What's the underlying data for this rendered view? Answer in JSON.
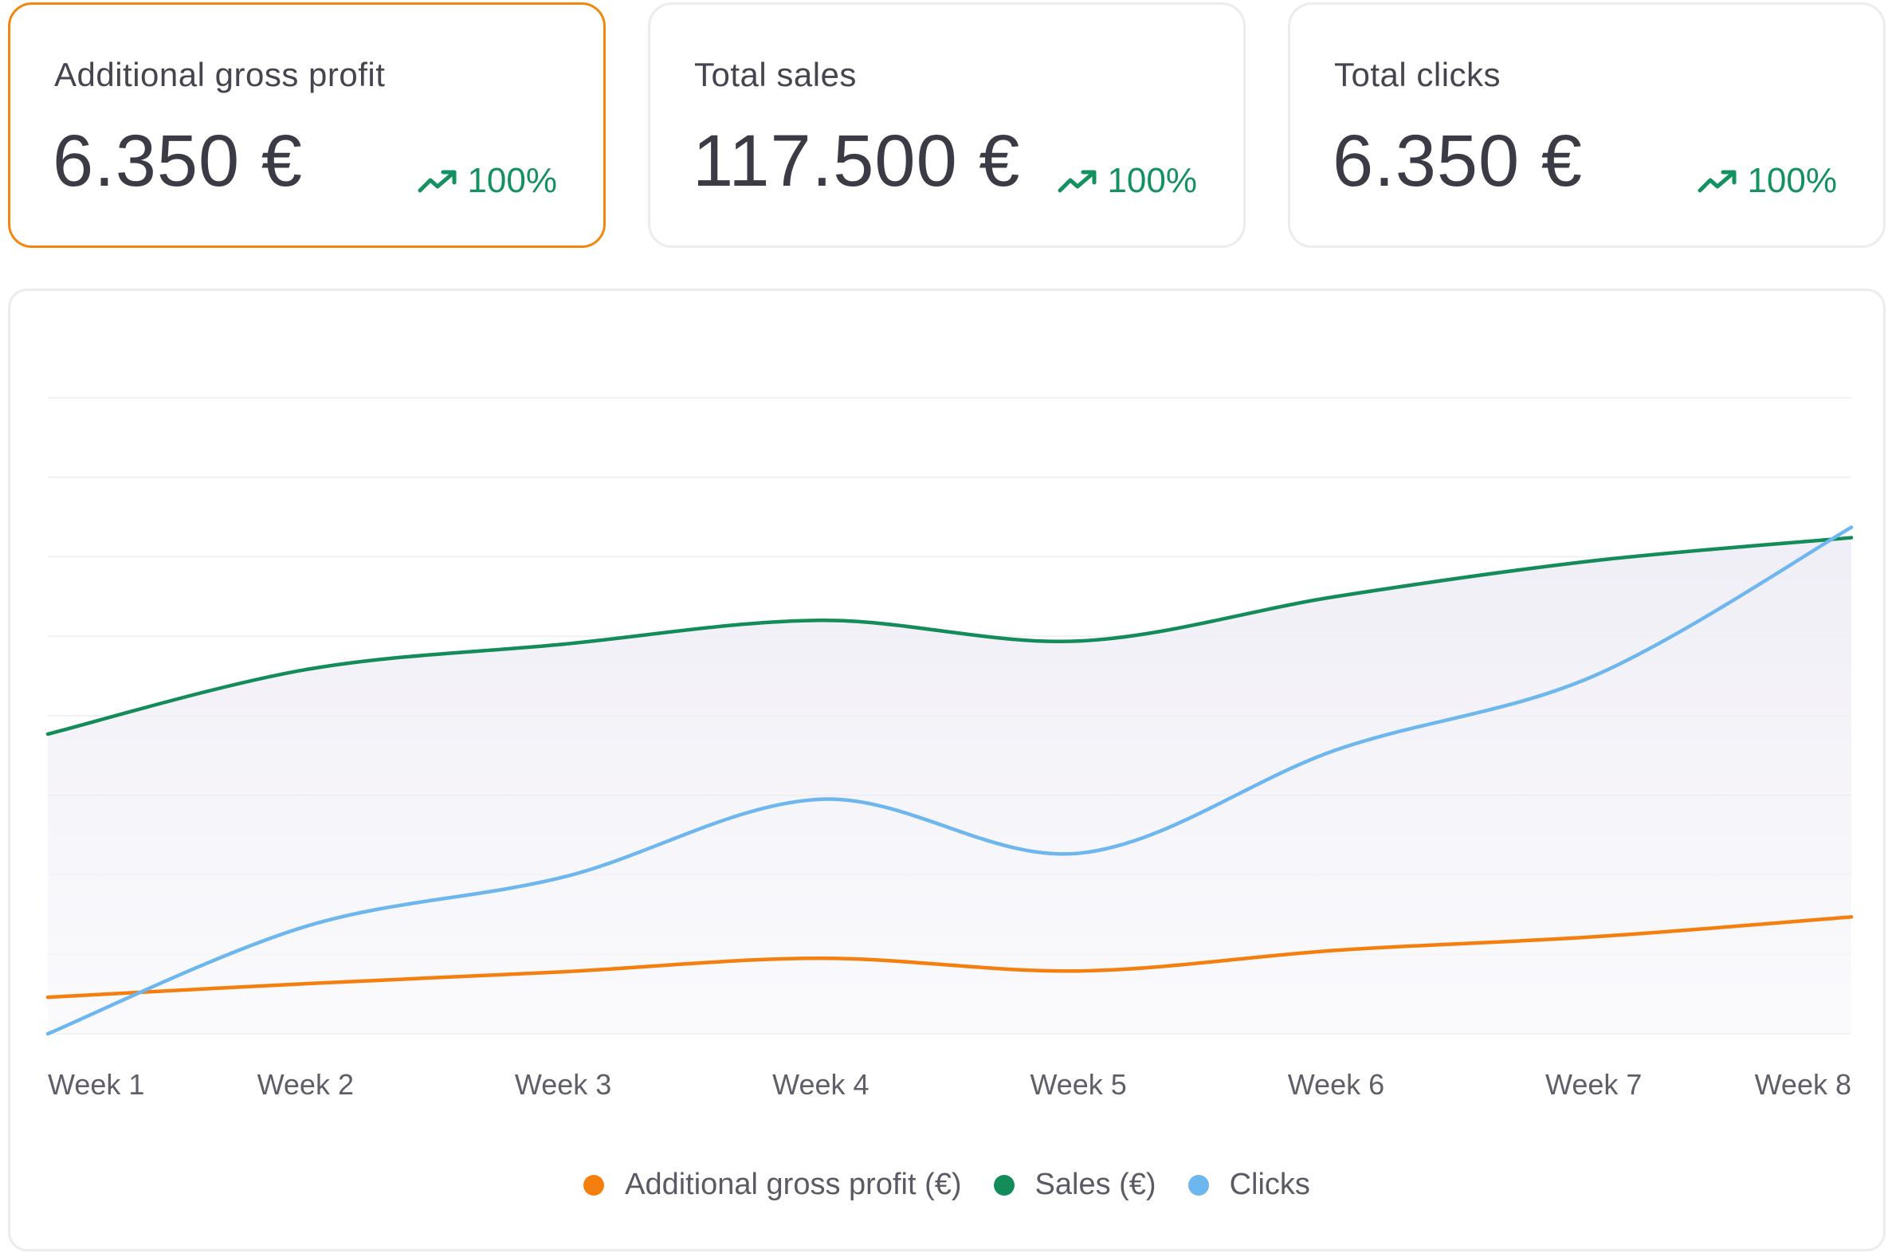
{
  "kpis": [
    {
      "label": "Additional gross profit",
      "value": "6.350 €",
      "change": "100%",
      "selected": true
    },
    {
      "label": "Total sales",
      "value": "117.500 €",
      "change": "100%",
      "selected": false
    },
    {
      "label": "Total clicks",
      "value": "6.350 €",
      "change": "100%",
      "selected": false
    }
  ],
  "colors": {
    "profit": "#f57f0e",
    "sales": "#148c5a",
    "clicks": "#6db6ee",
    "trend": "#149160",
    "selected_border": "#f3860f"
  },
  "chart_data": {
    "type": "line",
    "categories": [
      "Week 1",
      "Week 2",
      "Week 3",
      "Week 4",
      "Week 5",
      "Week 6",
      "Week 7",
      "Week 8"
    ],
    "series": [
      {
        "name": "Additional gross profit (€)",
        "color": "#f57f0e",
        "values": [
          0.46,
          0.63,
          0.78,
          0.95,
          0.79,
          1.05,
          1.22,
          1.47
        ]
      },
      {
        "name": "Sales (€)",
        "color": "#148c5a",
        "values": [
          3.77,
          4.58,
          4.9,
          5.2,
          4.94,
          5.5,
          5.95,
          6.24
        ]
      },
      {
        "name": "Clicks",
        "color": "#6db6ee",
        "values": [
          0.0,
          1.35,
          1.97,
          2.95,
          2.27,
          3.57,
          4.5,
          6.37
        ]
      }
    ],
    "ylim": [
      0,
      8
    ],
    "grid": true,
    "legend": "bottom"
  }
}
